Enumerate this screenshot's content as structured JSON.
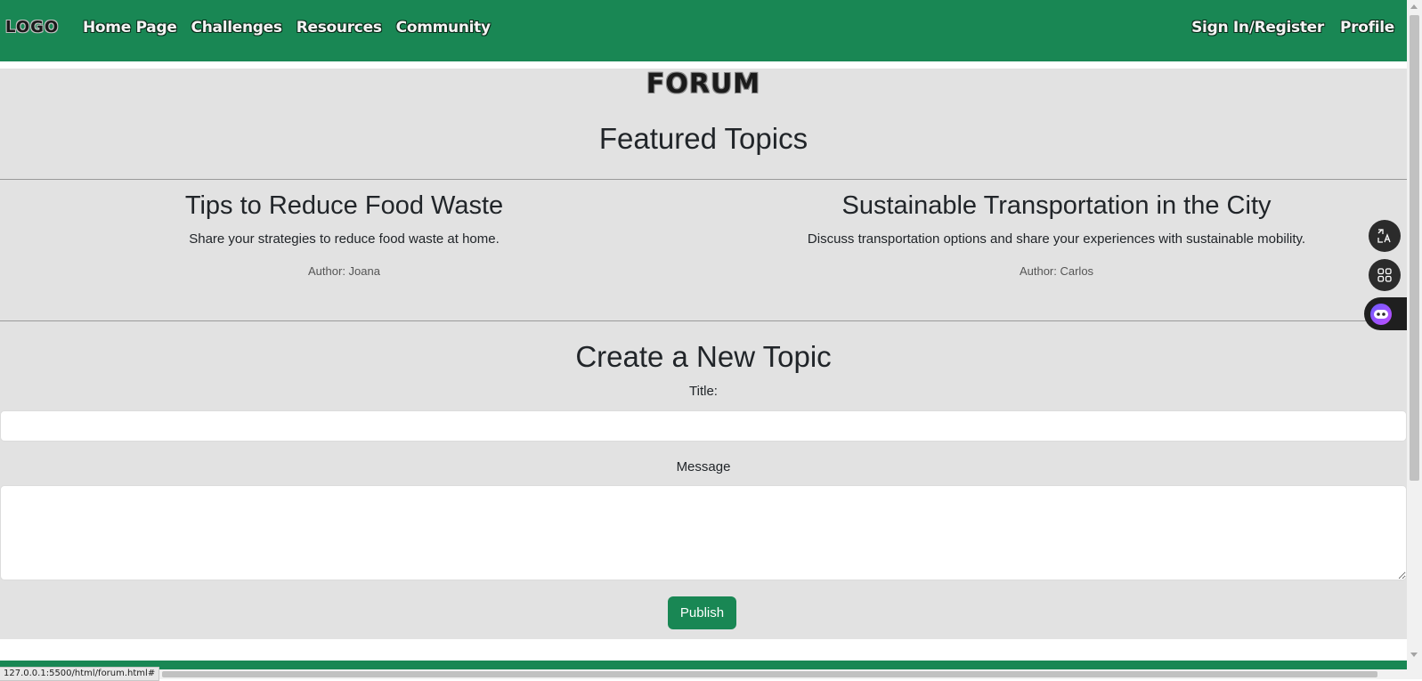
{
  "navbar": {
    "logo": "LOGO",
    "links": [
      "Home Page",
      "Challenges",
      "Resources",
      "Community"
    ],
    "right_links": [
      "Sign In/Register",
      "Profile"
    ]
  },
  "forum": {
    "heading": "FORUM",
    "featured_heading": "Featured Topics",
    "topics": [
      {
        "title": "Tips to Reduce Food Waste",
        "description": "Share your strategies to reduce food waste at home.",
        "author": "Author: Joana"
      },
      {
        "title": "Sustainable Transportation in the City",
        "description": "Discuss transportation options and share your experiences with sustainable mobility.",
        "author": "Author: Carlos"
      }
    ]
  },
  "create_topic": {
    "heading": "Create a New Topic",
    "title_label": "Title:",
    "title_value": "",
    "message_label": "Message",
    "message_value": "",
    "publish_label": "Publish"
  },
  "floating_tools": [
    "translate-icon",
    "apps-grid-icon",
    "assistant-bot-icon"
  ],
  "status_bar": {
    "url": "127.0.0.1:5500/html/forum.html#"
  },
  "colors": {
    "brand": "#198754",
    "background": "#e2e2e2"
  }
}
